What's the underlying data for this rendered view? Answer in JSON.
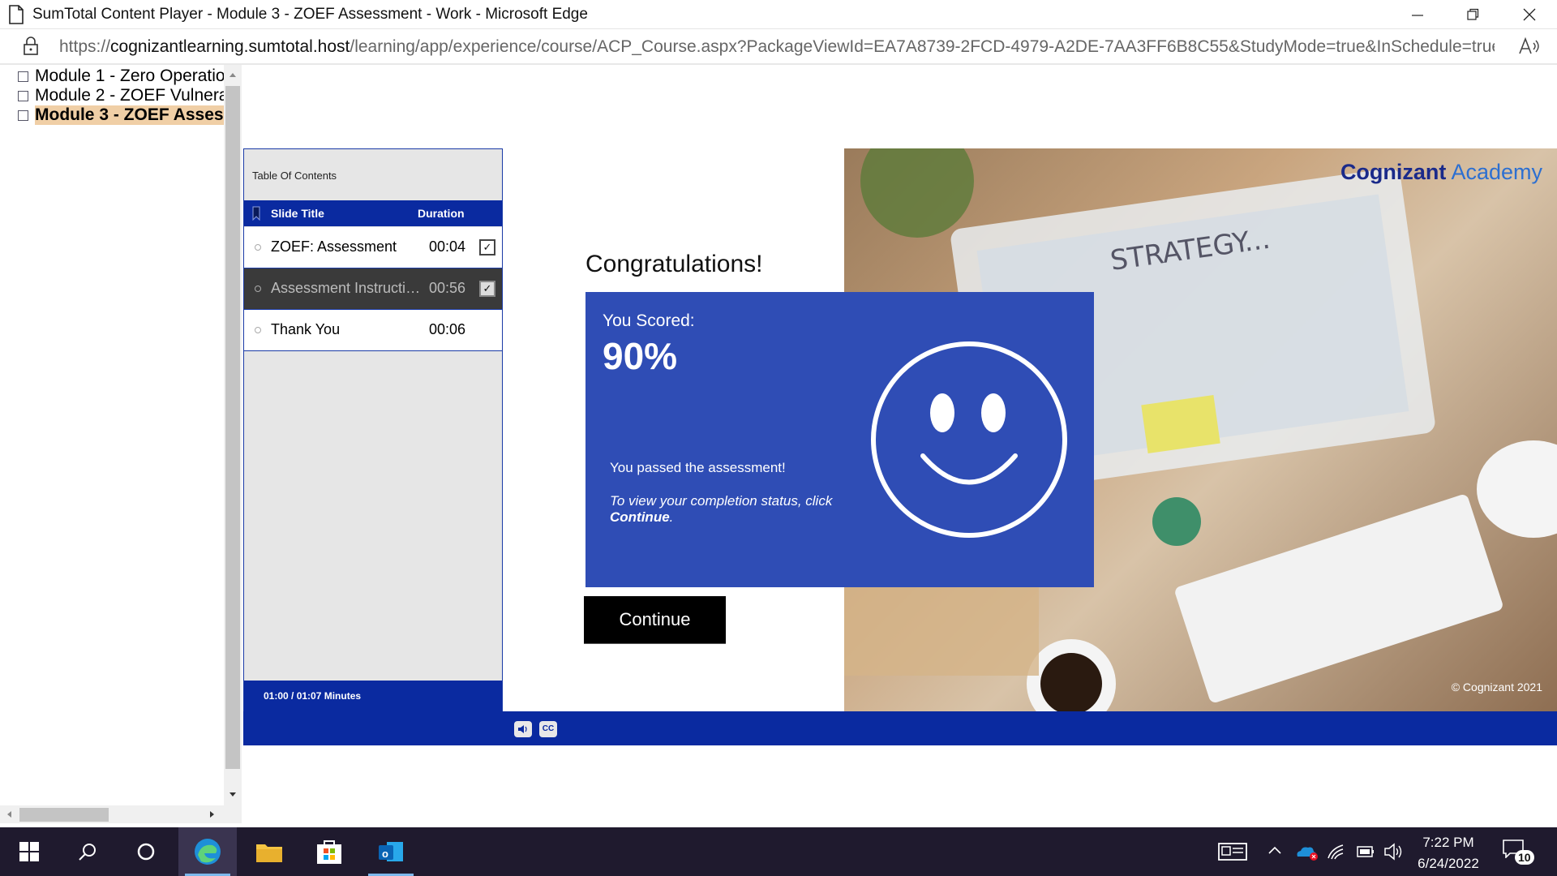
{
  "window": {
    "title": "SumTotal Content Player - Module 3 - ZOEF Assessment - Work - Microsoft Edge"
  },
  "address_bar": {
    "url_prefix": "https://",
    "url_host": "cognizantlearning.sumtotal.host",
    "url_path": "/learning/app/experience/course/ACP_Course.aspx?PackageViewId=EA7A8739-2FCD-4979-A2DE-7AA3FF6B8C55&StudyMode=true&InSchedule=true..."
  },
  "module_tree": {
    "items": [
      {
        "label": "Module 1 - Zero Operatio",
        "active": false
      },
      {
        "label": "Module 2 - ZOEF Vulnera",
        "active": false
      },
      {
        "label": "Module 3 - ZOEF Asses",
        "active": true
      }
    ]
  },
  "toc": {
    "title": "Table Of Contents",
    "col_title": "Slide Title",
    "col_duration": "Duration",
    "rows": [
      {
        "title": "ZOEF: Assessment",
        "duration": "00:04",
        "checked": true
      },
      {
        "title": "Assessment Instructio...",
        "duration": "00:56",
        "checked": true
      },
      {
        "title": "Thank You",
        "duration": "00:06",
        "checked": false
      }
    ],
    "footer": "01:00 / 01:07 Minutes"
  },
  "slide": {
    "heading": "Congratulations!",
    "score_label": "You Scored:",
    "score_value": "90%",
    "passed_text": "You passed the assessment!",
    "instruction_before": "To view your completion status, click ",
    "instruction_bold": "Continue",
    "instruction_after": ".",
    "continue_label": "Continue",
    "brand_name": "Cognizant",
    "brand_suffix": "Academy",
    "copyright": "© Cognizant 2021",
    "box_color": "#2f4db5"
  },
  "controls": {
    "audio_icon": "speaker-icon",
    "cc_label": "CC"
  },
  "taskbar": {
    "time": "7:22 PM",
    "date": "6/24/2022",
    "notification_count": "10"
  }
}
